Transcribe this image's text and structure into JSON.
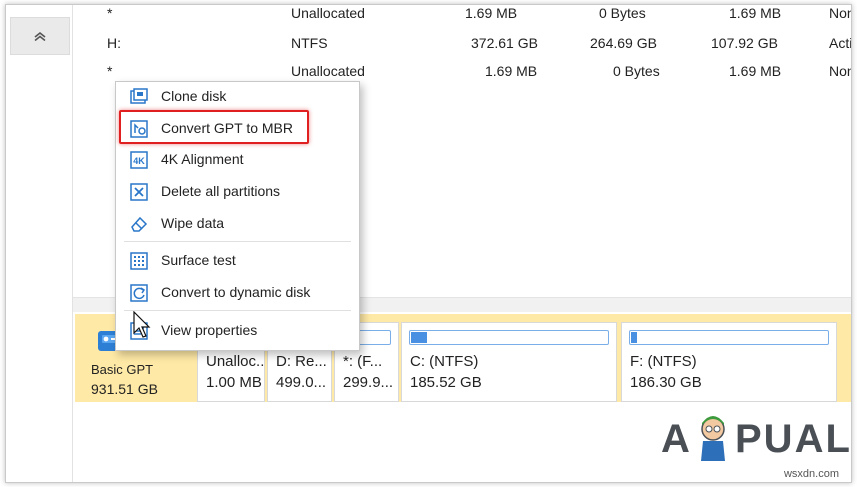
{
  "partitions": [
    {
      "name": "*",
      "fs": "Unallocated",
      "capacity": "1.69 MB",
      "used": "0 Bytes",
      "unused": "1.69 MB",
      "status": "Non"
    },
    {
      "name": "H:",
      "fs": "NTFS",
      "capacity": "372.61 GB",
      "used": "264.69 GB",
      "unused": "107.92 GB",
      "status": "Acti"
    },
    {
      "name": "*",
      "fs": "Unallocated",
      "capacity": "1.69 MB",
      "used": "0 Bytes",
      "unused": "1.69 MB",
      "status": "Non"
    }
  ],
  "context_menu": {
    "items": [
      {
        "label": "Clone disk",
        "icon": "clone-disk-icon"
      },
      {
        "label": "Convert GPT to MBR",
        "icon": "convert-gpt-to-mbr-icon"
      },
      {
        "label": "4K Alignment",
        "icon": "4k-alignment-icon"
      },
      {
        "label": "Delete all partitions",
        "icon": "delete-all-partitions-icon"
      },
      {
        "label": "Wipe data",
        "icon": "wipe-data-icon"
      },
      {
        "label": "Surface test",
        "icon": "surface-test-icon"
      },
      {
        "label": "Convert to dynamic disk",
        "icon": "convert-dynamic-disk-icon"
      },
      {
        "label": "View properties",
        "icon": "view-properties-icon"
      }
    ]
  },
  "disk_map": {
    "disk": {
      "type": "Basic GPT",
      "size": "931.51 GB"
    },
    "parts": [
      {
        "label": "Unalloc...",
        "size": "1.00 MB",
        "fill": 0
      },
      {
        "label": "D: Re...",
        "size": "499.0...",
        "fill": 0.4
      },
      {
        "label": "*: (F...",
        "size": "299.9...",
        "fill": 0.1
      },
      {
        "label": "C: (NTFS)",
        "size": "185.52 GB",
        "fill": 0.08
      },
      {
        "label": "F: (NTFS)",
        "size": "186.30 GB",
        "fill": 0.03
      }
    ]
  },
  "logo": {
    "text_left": "A",
    "text_right": "PUALS"
  },
  "watermark": "wsxdn.com",
  "colors": {
    "highlight": "#e02020",
    "disk_map_bg": "#ffe9a6",
    "accent": "#4a90e2"
  }
}
